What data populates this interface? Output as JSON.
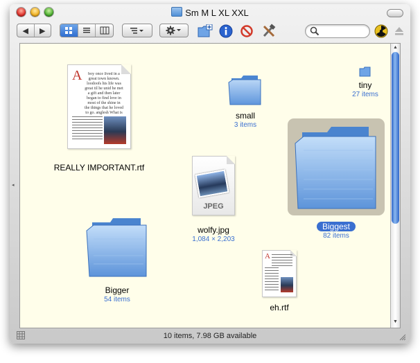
{
  "window": {
    "title": "Sm M L XL XXL",
    "status": "10 items, 7.98 GB available"
  },
  "toolbar": {
    "nav": {
      "back": "◀",
      "forward": "▶"
    },
    "view_modes": [
      "icon-view-icon",
      "list-view-icon",
      "column-view-icon"
    ],
    "active_view": "icon",
    "arrange_icon": "arrange-icon",
    "action_icon": "gear-icon",
    "search_placeholder": ""
  },
  "items": {
    "really_important": {
      "name": "REALLY IMPORTANT.rtf",
      "preview_initial": "A",
      "preview_text": "boy once lived in a great town known. loodoofs his life was great til he unid he met a gift and then later began to find love in most of the shine in the things that he loved to go. anglesh What is it up in a great town"
    },
    "small": {
      "name": "small",
      "info": "3 items"
    },
    "tiny": {
      "name": "tiny",
      "info": "27 items"
    },
    "wolfy": {
      "name": "wolfy.jpg",
      "info": "1,084 × 2,203",
      "badge": "JPEG"
    },
    "biggest": {
      "name": "Biggest",
      "info": "82 items"
    },
    "bigger": {
      "name": "Bigger",
      "info": "54 items"
    },
    "eh": {
      "name": "eh.rtf"
    }
  },
  "colors": {
    "selection": "#3a6fd0",
    "content_bg": "#fffeea",
    "folder_blue": "#7fb0e8"
  }
}
